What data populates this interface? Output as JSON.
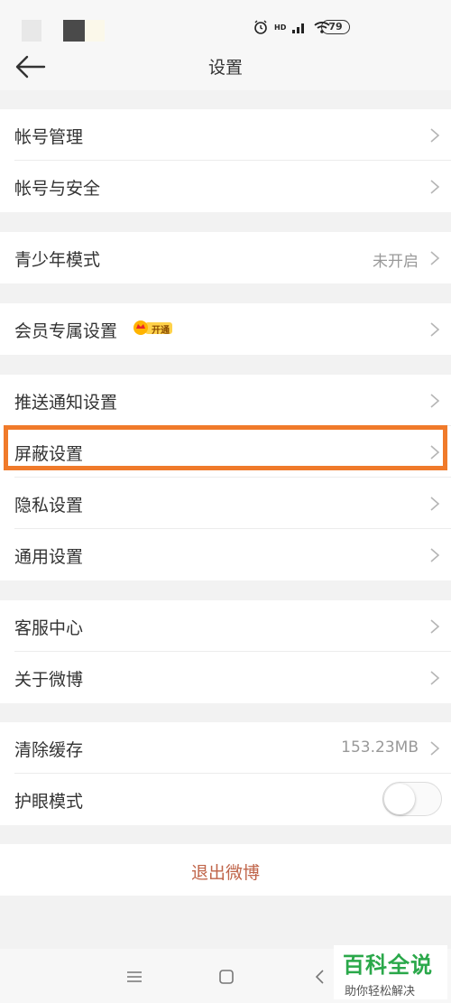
{
  "header": {
    "title": "设置"
  },
  "groups": [
    {
      "items": [
        {
          "label": "帐号管理"
        },
        {
          "label": "帐号与安全"
        }
      ]
    },
    {
      "items": [
        {
          "label": "青少年模式",
          "value": "未开启"
        }
      ]
    },
    {
      "items": [
        {
          "label": "会员专属设置",
          "badge": "开通"
        }
      ]
    },
    {
      "items": [
        {
          "label": "推送通知设置"
        },
        {
          "label": "屏蔽设置"
        },
        {
          "label": "隐私设置"
        },
        {
          "label": "通用设置"
        }
      ]
    },
    {
      "items": [
        {
          "label": "客服中心"
        },
        {
          "label": "关于微博"
        }
      ]
    },
    {
      "items": [
        {
          "label": "清除缓存",
          "value": "153.23MB"
        },
        {
          "label": "护眼模式",
          "toggle": false
        }
      ]
    }
  ],
  "logout": {
    "label": "退出微博"
  },
  "status_bar": {
    "battery": "79",
    "network": "HD"
  },
  "watermark": {
    "title": "百科全说",
    "subtitle": "助你轻松解决"
  },
  "colors": {
    "highlight": "#f07a2a",
    "logout": "#c0654a",
    "watermark": "#2aa84a"
  }
}
